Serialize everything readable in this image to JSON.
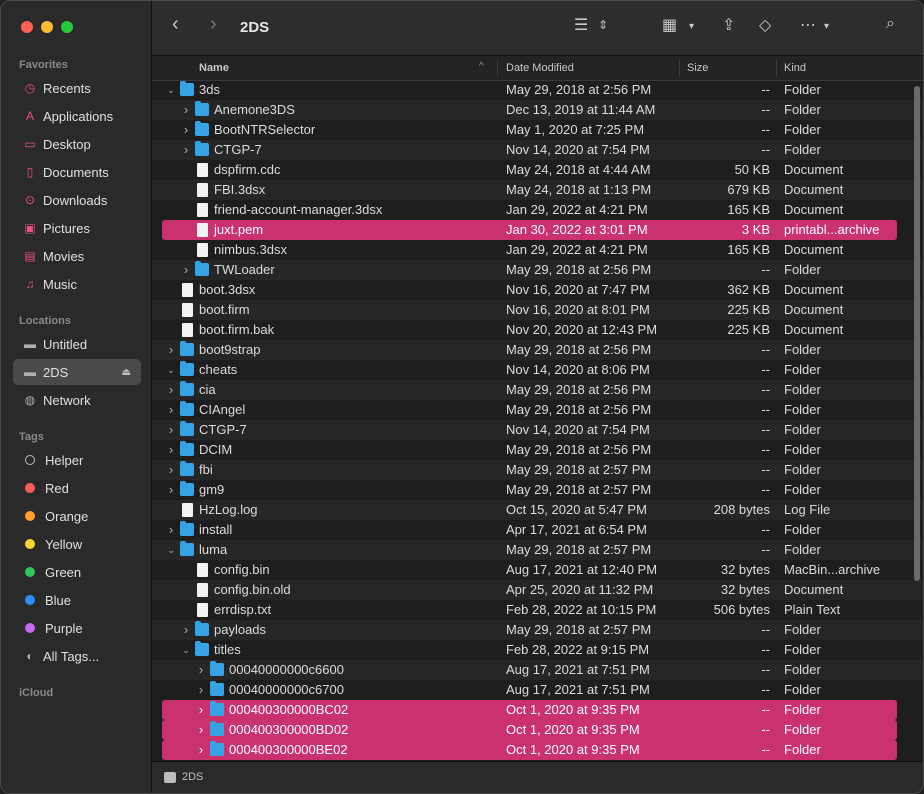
{
  "toolbar": {
    "title": "2DS",
    "back_icon": "chevron-left-icon",
    "forward_icon": "chevron-right-icon"
  },
  "sidebar": {
    "favorites_label": "Favorites",
    "favorites": [
      {
        "label": "Recents",
        "icon": "clock-icon"
      },
      {
        "label": "Applications",
        "icon": "applications-icon"
      },
      {
        "label": "Desktop",
        "icon": "desktop-icon"
      },
      {
        "label": "Documents",
        "icon": "document-icon"
      },
      {
        "label": "Downloads",
        "icon": "download-icon"
      },
      {
        "label": "Pictures",
        "icon": "pictures-icon"
      },
      {
        "label": "Movies",
        "icon": "film-icon"
      },
      {
        "label": "Music",
        "icon": "music-icon"
      }
    ],
    "locations_label": "Locations",
    "locations": [
      {
        "label": "Untitled",
        "icon": "disk-icon"
      },
      {
        "label": "2DS",
        "icon": "disk-icon"
      },
      {
        "label": "Network",
        "icon": "globe-icon"
      }
    ],
    "tags_label": "Tags",
    "tags": [
      {
        "label": "Helper",
        "color": "transparent"
      },
      {
        "label": "Red",
        "color": "#ff5b5b"
      },
      {
        "label": "Orange",
        "color": "#ff9f2e"
      },
      {
        "label": "Yellow",
        "color": "#f5d72d"
      },
      {
        "label": "Green",
        "color": "#30c65a"
      },
      {
        "label": "Blue",
        "color": "#2f8cff"
      },
      {
        "label": "Purple",
        "color": "#c56af2"
      },
      {
        "label": "All Tags...",
        "color": "all"
      }
    ],
    "icloud_label": "iCloud"
  },
  "columns": {
    "name": "Name",
    "date": "Date Modified",
    "size": "Size",
    "kind": "Kind"
  },
  "rows": [
    {
      "name": "3ds",
      "date": "May 29, 2018 at 2:56 PM",
      "size": "--",
      "kind": "Folder",
      "type": "folder",
      "indent": 0,
      "disc": "open",
      "hl": false
    },
    {
      "name": "Anemone3DS",
      "date": "Dec 13, 2019 at 11:44 AM",
      "size": "--",
      "kind": "Folder",
      "type": "folder",
      "indent": 1,
      "disc": "closed",
      "hl": false
    },
    {
      "name": "BootNTRSelector",
      "date": "May 1, 2020 at 7:25 PM",
      "size": "--",
      "kind": "Folder",
      "type": "folder",
      "indent": 1,
      "disc": "closed",
      "hl": false
    },
    {
      "name": "CTGP-7",
      "date": "Nov 14, 2020 at 7:54 PM",
      "size": "--",
      "kind": "Folder",
      "type": "folder",
      "indent": 1,
      "disc": "closed",
      "hl": false
    },
    {
      "name": "dspfirm.cdc",
      "date": "May 24, 2018 at 4:44 AM",
      "size": "50 KB",
      "kind": "Document",
      "type": "doc",
      "indent": 1,
      "disc": "none",
      "hl": false
    },
    {
      "name": "FBI.3dsx",
      "date": "May 24, 2018 at 1:13 PM",
      "size": "679 KB",
      "kind": "Document",
      "type": "doc",
      "indent": 1,
      "disc": "none",
      "hl": false
    },
    {
      "name": "friend-account-manager.3dsx",
      "date": "Jan 29, 2022 at 4:21 PM",
      "size": "165 KB",
      "kind": "Document",
      "type": "doc",
      "indent": 1,
      "disc": "none",
      "hl": false
    },
    {
      "name": "juxt.pem",
      "date": "Jan 30, 2022 at 3:01 PM",
      "size": "3 KB",
      "kind": "printabl...archive",
      "type": "doc",
      "indent": 1,
      "disc": "none",
      "hl": true
    },
    {
      "name": "nimbus.3dsx",
      "date": "Jan 29, 2022 at 4:21 PM",
      "size": "165 KB",
      "kind": "Document",
      "type": "doc",
      "indent": 1,
      "disc": "none",
      "hl": false
    },
    {
      "name": "TWLoader",
      "date": "May 29, 2018 at 2:56 PM",
      "size": "--",
      "kind": "Folder",
      "type": "folder",
      "indent": 1,
      "disc": "closed",
      "hl": false
    },
    {
      "name": "boot.3dsx",
      "date": "Nov 16, 2020 at 7:47 PM",
      "size": "362 KB",
      "kind": "Document",
      "type": "doc",
      "indent": 0,
      "disc": "none",
      "hl": false
    },
    {
      "name": "boot.firm",
      "date": "Nov 16, 2020 at 8:01 PM",
      "size": "225 KB",
      "kind": "Document",
      "type": "doc",
      "indent": 0,
      "disc": "none",
      "hl": false
    },
    {
      "name": "boot.firm.bak",
      "date": "Nov 20, 2020 at 12:43 PM",
      "size": "225 KB",
      "kind": "Document",
      "type": "doc",
      "indent": 0,
      "disc": "none",
      "hl": false
    },
    {
      "name": "boot9strap",
      "date": "May 29, 2018 at 2:56 PM",
      "size": "--",
      "kind": "Folder",
      "type": "folder",
      "indent": 0,
      "disc": "closed",
      "hl": false
    },
    {
      "name": "cheats",
      "date": "Nov 14, 2020 at 8:06 PM",
      "size": "--",
      "kind": "Folder",
      "type": "folder",
      "indent": 0,
      "disc": "open",
      "hl": false
    },
    {
      "name": "cia",
      "date": "May 29, 2018 at 2:56 PM",
      "size": "--",
      "kind": "Folder",
      "type": "folder",
      "indent": 0,
      "disc": "closed",
      "hl": false
    },
    {
      "name": "CIAngel",
      "date": "May 29, 2018 at 2:56 PM",
      "size": "--",
      "kind": "Folder",
      "type": "folder",
      "indent": 0,
      "disc": "closed",
      "hl": false
    },
    {
      "name": "CTGP-7",
      "date": "Nov 14, 2020 at 7:54 PM",
      "size": "--",
      "kind": "Folder",
      "type": "folder",
      "indent": 0,
      "disc": "closed",
      "hl": false
    },
    {
      "name": "DCIM",
      "date": "May 29, 2018 at 2:56 PM",
      "size": "--",
      "kind": "Folder",
      "type": "folder",
      "indent": 0,
      "disc": "closed",
      "hl": false
    },
    {
      "name": "fbi",
      "date": "May 29, 2018 at 2:57 PM",
      "size": "--",
      "kind": "Folder",
      "type": "folder",
      "indent": 0,
      "disc": "closed",
      "hl": false
    },
    {
      "name": "gm9",
      "date": "May 29, 2018 at 2:57 PM",
      "size": "--",
      "kind": "Folder",
      "type": "folder",
      "indent": 0,
      "disc": "closed",
      "hl": false
    },
    {
      "name": "HzLog.log",
      "date": "Oct 15, 2020 at 5:47 PM",
      "size": "208 bytes",
      "kind": "Log File",
      "type": "doc",
      "indent": 0,
      "disc": "none",
      "hl": false
    },
    {
      "name": "install",
      "date": "Apr 17, 2021 at 6:54 PM",
      "size": "--",
      "kind": "Folder",
      "type": "folder",
      "indent": 0,
      "disc": "closed",
      "hl": false
    },
    {
      "name": "luma",
      "date": "May 29, 2018 at 2:57 PM",
      "size": "--",
      "kind": "Folder",
      "type": "folder",
      "indent": 0,
      "disc": "open",
      "hl": false
    },
    {
      "name": "config.bin",
      "date": "Aug 17, 2021 at 12:40 PM",
      "size": "32 bytes",
      "kind": "MacBin...archive",
      "type": "doc",
      "indent": 1,
      "disc": "none",
      "hl": false
    },
    {
      "name": "config.bin.old",
      "date": "Apr 25, 2020 at 11:32 PM",
      "size": "32 bytes",
      "kind": "Document",
      "type": "doc",
      "indent": 1,
      "disc": "none",
      "hl": false
    },
    {
      "name": "errdisp.txt",
      "date": "Feb 28, 2022 at 10:15 PM",
      "size": "506 bytes",
      "kind": "Plain Text",
      "type": "doc",
      "indent": 1,
      "disc": "none",
      "hl": false
    },
    {
      "name": "payloads",
      "date": "May 29, 2018 at 2:57 PM",
      "size": "--",
      "kind": "Folder",
      "type": "folder",
      "indent": 1,
      "disc": "closed",
      "hl": false
    },
    {
      "name": "titles",
      "date": "Feb 28, 2022 at 9:15 PM",
      "size": "--",
      "kind": "Folder",
      "type": "folder",
      "indent": 1,
      "disc": "open",
      "hl": false
    },
    {
      "name": "00040000000c6600",
      "date": "Aug 17, 2021 at 7:51 PM",
      "size": "--",
      "kind": "Folder",
      "type": "folder",
      "indent": 2,
      "disc": "closed",
      "hl": false
    },
    {
      "name": "00040000000c6700",
      "date": "Aug 17, 2021 at 7:51 PM",
      "size": "--",
      "kind": "Folder",
      "type": "folder",
      "indent": 2,
      "disc": "closed",
      "hl": false
    },
    {
      "name": "000400300000BC02",
      "date": "Oct 1, 2020 at 9:35 PM",
      "size": "--",
      "kind": "Folder",
      "type": "folder",
      "indent": 2,
      "disc": "closed",
      "hl": true
    },
    {
      "name": "000400300000BD02",
      "date": "Oct 1, 2020 at 9:35 PM",
      "size": "--",
      "kind": "Folder",
      "type": "folder",
      "indent": 2,
      "disc": "closed",
      "hl": true
    },
    {
      "name": "000400300000BE02",
      "date": "Oct 1, 2020 at 9:35 PM",
      "size": "--",
      "kind": "Folder",
      "type": "folder",
      "indent": 2,
      "disc": "closed",
      "hl": true
    }
  ],
  "pathbar": {
    "label": "2DS"
  },
  "colors": {
    "highlight": "#c9316f",
    "folder": "#36a3e6",
    "sidebar_accent": "#ec4d89"
  }
}
